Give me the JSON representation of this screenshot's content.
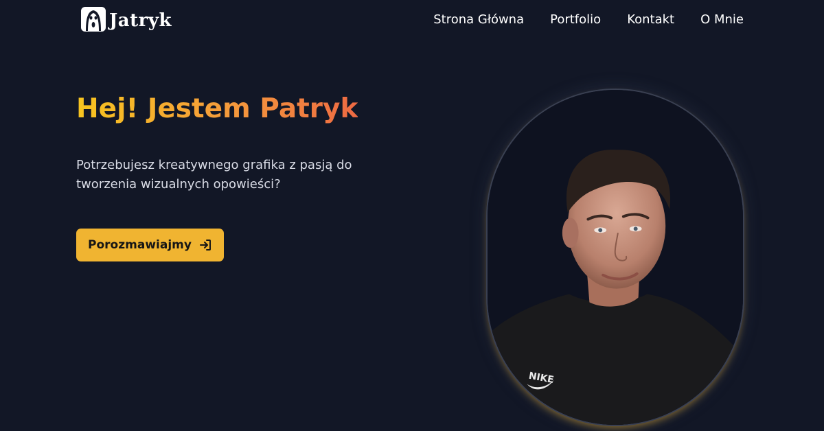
{
  "brand": {
    "name": "Jatryk",
    "logo_icon": "scream-mask-icon"
  },
  "nav": {
    "items": [
      {
        "label": "Strona Główna"
      },
      {
        "label": "Portfolio"
      },
      {
        "label": "Kontakt"
      },
      {
        "label": "O Mnie"
      }
    ]
  },
  "hero": {
    "title": "Hej! Jestem Patryk",
    "subtitle_line1": "Potrzebujesz kreatywnego grafika z pasją do",
    "subtitle_line2": "tworzenia wizualnych opowieści?",
    "cta_label": "Porozmawiajmy",
    "cta_icon": "login-arrow-icon",
    "portrait_logo_text": "NIKE"
  },
  "colors": {
    "background": "#121726",
    "accent": "#f0b431",
    "gradient_start": "#f7c51f",
    "gradient_end": "#ee6a43"
  }
}
